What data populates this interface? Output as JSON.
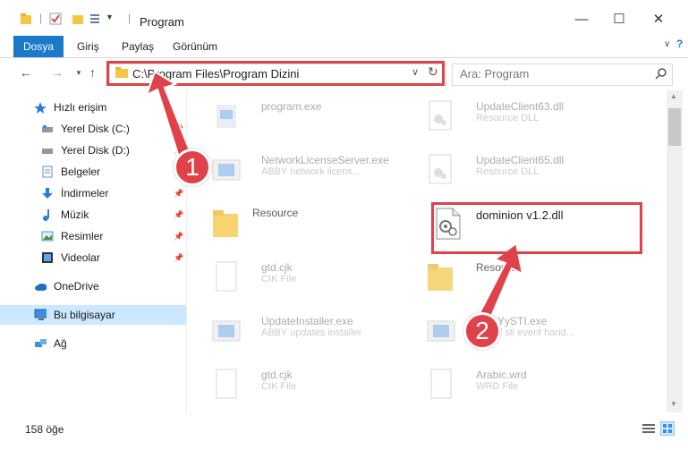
{
  "window": {
    "title": "Program"
  },
  "ribbon": {
    "tabs": [
      "Dosya",
      "Giriş",
      "Paylaş",
      "Görünüm"
    ]
  },
  "address": {
    "path": "C:\\Program Files\\Program Dizini"
  },
  "search": {
    "placeholder": "Ara: Program"
  },
  "sidebar": {
    "items": [
      {
        "label": "Hızlı erişim"
      },
      {
        "label": "Yerel Disk (C:)"
      },
      {
        "label": "Yerel Disk (D:)"
      },
      {
        "label": "Belgeler"
      },
      {
        "label": "İndirmeler"
      },
      {
        "label": "Müzik"
      },
      {
        "label": "Resimler"
      },
      {
        "label": "Videolar"
      },
      {
        "label": "OneDrive"
      },
      {
        "label": "Bu bilgisayar"
      },
      {
        "label": "Ağ"
      }
    ]
  },
  "files": [
    {
      "name": "program.exe",
      "desc": ""
    },
    {
      "name": "UpdateClient63.dll",
      "desc": "Resource DLL"
    },
    {
      "name": "NetworkLicenseServer.exe",
      "desc": "ABBY network licens..."
    },
    {
      "name": "UpdateClient65.dll",
      "desc": "Resource DLL"
    },
    {
      "name": "Resource",
      "desc": ""
    },
    {
      "name": "dominion v1.2.dll",
      "desc": ""
    },
    {
      "name": "gtd.cjk",
      "desc": "CIK File"
    },
    {
      "name": "Resource",
      "desc": ""
    },
    {
      "name": "UpdateInstaller.exe",
      "desc": "ABBY updates installer"
    },
    {
      "name": "ABBYySTI.exe",
      "desc": "ABBY sti event hand..."
    },
    {
      "name": "gtd.cjk",
      "desc": "CIK File"
    },
    {
      "name": "Arabic.wrd",
      "desc": "WRD File"
    }
  ],
  "status": {
    "count": "158 öğe"
  },
  "annotations": {
    "step1": "1",
    "step2": "2",
    "color": "#e0424a"
  }
}
